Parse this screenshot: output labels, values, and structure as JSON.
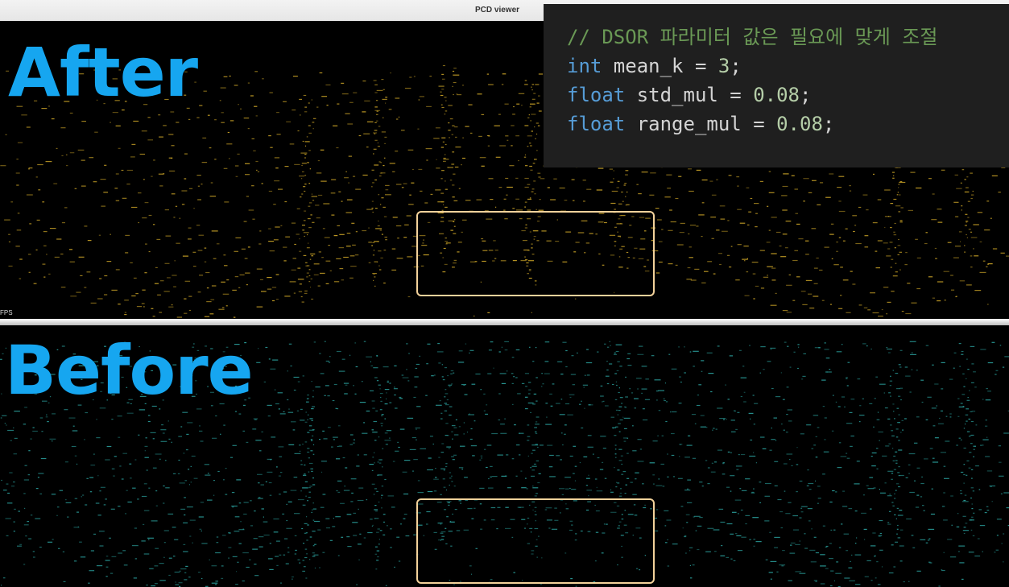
{
  "window": {
    "title": "PCD viewer"
  },
  "after_view": {
    "label": "After",
    "fps_text": "FPS",
    "point_color": "#c9a227"
  },
  "before_view": {
    "label": "Before",
    "point_color": "#2a9d9a"
  },
  "label_color": "#16a6f0",
  "box_color": "#f3d29b",
  "code": {
    "comment": "// DSOR 파라미터 값은 필요에 맞게 조절",
    "lines": [
      {
        "type": "int",
        "rest": " mean_k = ",
        "value": "3",
        "end": ";"
      },
      {
        "type": "float",
        "rest": " std_mul = ",
        "value": "0.08",
        "end": ";"
      },
      {
        "type": "float",
        "rest": " range_mul = ",
        "value": "0.08",
        "end": ";"
      }
    ]
  }
}
